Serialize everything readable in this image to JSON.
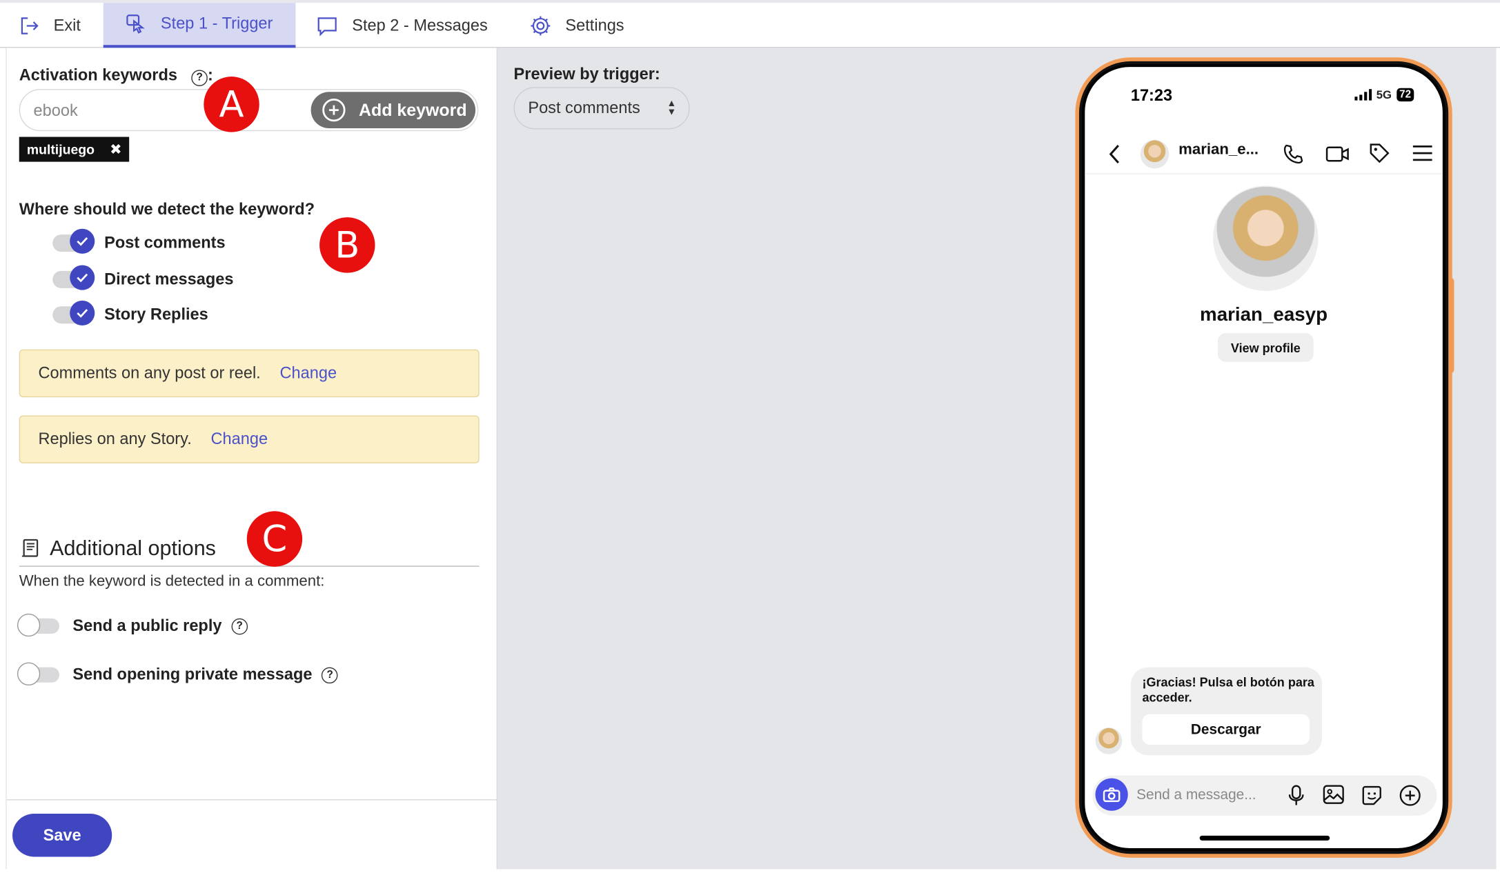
{
  "nav": {
    "exit": "Exit",
    "step1": "Step 1 - Trigger",
    "step2": "Step 2 - Messages",
    "settings": "Settings"
  },
  "keywords": {
    "label": "Activation keywords",
    "colon": ":",
    "placeholder": "ebook",
    "add_label": "Add keyword",
    "chips": [
      "multijuego"
    ]
  },
  "badges": {
    "a": "A",
    "b": "B",
    "c": "C"
  },
  "detect": {
    "question": "Where should we detect the keyword?",
    "options": [
      "Post comments",
      "Direct messages",
      "Story Replies"
    ]
  },
  "notices": {
    "comments": "Comments on any post or reel.",
    "stories": "Replies on any Story.",
    "change": "Change"
  },
  "additional": {
    "title": "Additional options",
    "desc": "When the keyword is detected in a comment:",
    "opt1": "Send a public reply",
    "opt2": "Send opening private message"
  },
  "footer": {
    "save": "Save"
  },
  "preview": {
    "label": "Preview by trigger:",
    "selected": "Post comments"
  },
  "phone": {
    "time": "17:23",
    "network": "5G",
    "battery": "72",
    "header_name": "marian_e...",
    "profile_name": "marian_easyp",
    "view_profile": "View profile",
    "bubble_text": "¡Gracias! Pulsa el botón para acceder.",
    "bubble_button": "Descargar",
    "message_placeholder": "Send a message..."
  },
  "colors": {
    "accent": "#3f46c0",
    "badge": "#e80f0f",
    "phone_frame": "#f19b55",
    "notice_bg": "#fcf0c9"
  }
}
